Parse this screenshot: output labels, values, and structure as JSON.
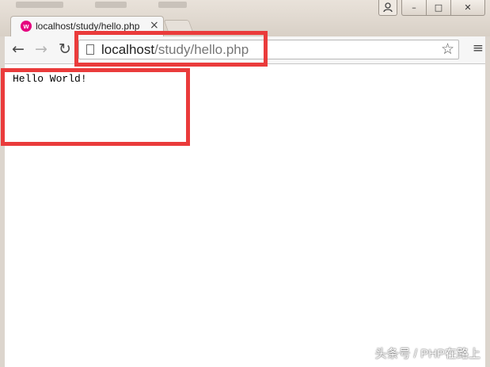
{
  "window": {
    "controls": {
      "user_icon": "user-icon",
      "minimize": "–",
      "maximize": "□",
      "close": "✕"
    }
  },
  "tab": {
    "title": "localhost/study/hello.php",
    "close_glyph": "×",
    "favicon_letter": "w",
    "favicon_color": "#e5007e"
  },
  "toolbar": {
    "back_glyph": "←",
    "forward_glyph": "→",
    "reload_glyph": "↻",
    "url_host": "localhost",
    "url_path": "/study/hello.php",
    "star_glyph": "☆",
    "menu_glyph": "≡"
  },
  "page": {
    "body_text": "Hello World!"
  },
  "annotations": {
    "highlight_color": "#ea3b3b"
  },
  "watermark": "头条号 / PHP在路上"
}
